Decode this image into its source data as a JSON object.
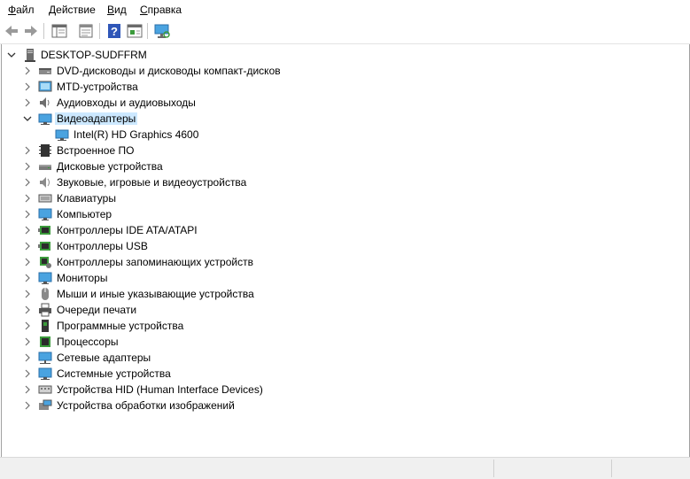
{
  "menu": [
    {
      "first": "Ф",
      "rest": "айл"
    },
    {
      "first": "Д",
      "rest": "ействие"
    },
    {
      "first": "В",
      "rest": "ид"
    },
    {
      "first": "С",
      "rest": "правка"
    }
  ],
  "toolbar": {
    "buttons": [
      "back-arrow-icon",
      "forward-arrow-icon",
      "show-hide-tree-icon",
      "properties-icon",
      "help-icon",
      "details-view-icon",
      "scan-hardware-icon"
    ]
  },
  "tree": {
    "root": {
      "label": "DESKTOP-SUDFFRM",
      "icon": "computer-icon"
    },
    "items": [
      {
        "label": "DVD-дисководы и дисководы компакт-дисков",
        "icon": "dvd-drive-icon",
        "expanded": false
      },
      {
        "label": "MTD-устройства",
        "icon": "mtd-device-icon",
        "expanded": false
      },
      {
        "label": "Аудиовходы и аудиовыходы",
        "icon": "audio-icon",
        "expanded": false
      },
      {
        "label": "Видеоадаптеры",
        "icon": "display-adapter-icon",
        "expanded": true,
        "selected": true,
        "children": [
          {
            "label": "Intel(R) HD Graphics 4600",
            "icon": "display-adapter-icon"
          }
        ]
      },
      {
        "label": "Встроенное ПО",
        "icon": "firmware-icon",
        "expanded": false
      },
      {
        "label": "Дисковые устройства",
        "icon": "disk-drive-icon",
        "expanded": false
      },
      {
        "label": "Звуковые, игровые и видеоустройства",
        "icon": "sound-icon",
        "expanded": false
      },
      {
        "label": "Клавиатуры",
        "icon": "keyboard-icon",
        "expanded": false
      },
      {
        "label": "Компьютер",
        "icon": "computer-monitor-icon",
        "expanded": false
      },
      {
        "label": "Контроллеры IDE ATA/ATAPI",
        "icon": "ide-controller-icon",
        "expanded": false
      },
      {
        "label": "Контроллеры USB",
        "icon": "usb-controller-icon",
        "expanded": false
      },
      {
        "label": "Контроллеры запоминающих устройств",
        "icon": "storage-controller-icon",
        "expanded": false
      },
      {
        "label": "Мониторы",
        "icon": "monitor-icon",
        "expanded": false
      },
      {
        "label": "Мыши и иные указывающие устройства",
        "icon": "mouse-icon",
        "expanded": false
      },
      {
        "label": "Очереди печати",
        "icon": "printer-icon",
        "expanded": false
      },
      {
        "label": "Программные устройства",
        "icon": "software-device-icon",
        "expanded": false
      },
      {
        "label": "Процессоры",
        "icon": "processor-icon",
        "expanded": false
      },
      {
        "label": "Сетевые адаптеры",
        "icon": "network-adapter-icon",
        "expanded": false
      },
      {
        "label": "Системные устройства",
        "icon": "system-device-icon",
        "expanded": false
      },
      {
        "label": "Устройства HID (Human Interface Devices)",
        "icon": "hid-icon",
        "expanded": false
      },
      {
        "label": "Устройства обработки изображений",
        "icon": "imaging-device-icon",
        "expanded": false
      }
    ]
  },
  "colors": {
    "selection": "#cce8ff",
    "icon_blue": "#2b7cd3",
    "chevron": "#6d6d6d"
  }
}
